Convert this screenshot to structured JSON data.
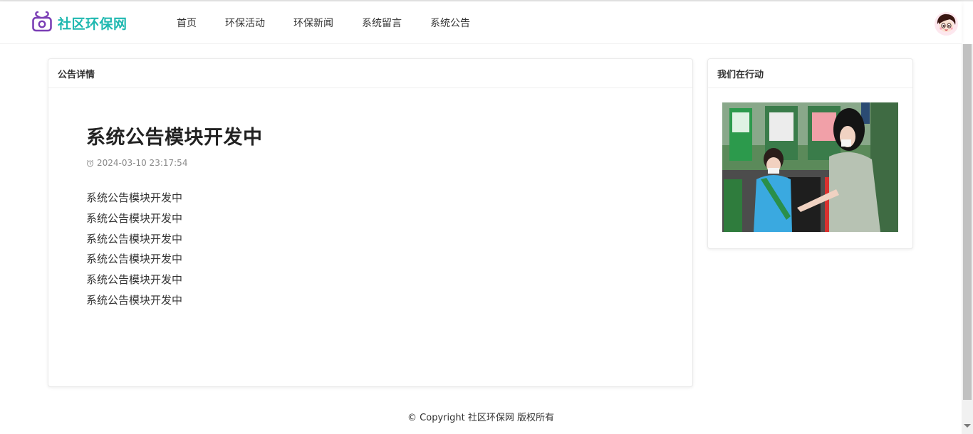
{
  "brand": {
    "name": "社区环保网",
    "logo_icon": "gift-box-icon"
  },
  "nav": {
    "items": [
      "首页",
      "环保活动",
      "环保新闻",
      "系统留言",
      "系统公告"
    ]
  },
  "user": {
    "avatar_icon": "cartoon-avatar"
  },
  "main_card": {
    "header": "公告详情",
    "title": "系统公告模块开发中",
    "time": "2024-03-10 23:17:54",
    "paragraphs": [
      "系统公告模块开发中",
      "系统公告模块开发中",
      "系统公告模块开发中",
      "系统公告模块开发中",
      "系统公告模块开发中",
      "系统公告模块开发中"
    ]
  },
  "side_card": {
    "header": "我们在行动",
    "image_alt": "garbage-sorting-volunteers-photo"
  },
  "footer": {
    "copyright": "© Copyright 社区环保网 版权所有"
  },
  "colors": {
    "brand": "#1fb8b0",
    "logo_purple": "#7b3fb5"
  }
}
